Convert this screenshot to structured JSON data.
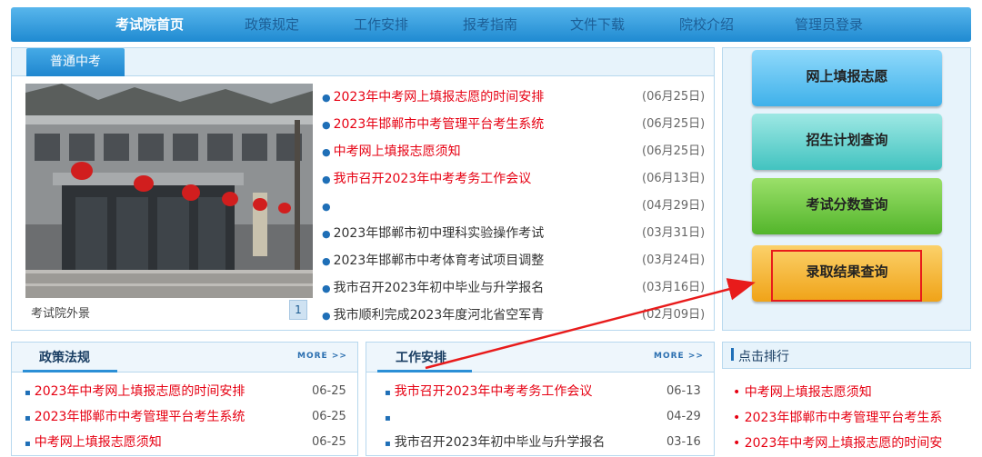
{
  "nav": {
    "items": [
      {
        "label": "考试院首页",
        "active": true
      },
      {
        "label": "政策规定",
        "active": false
      },
      {
        "label": "工作安排",
        "active": false
      },
      {
        "label": "报考指南",
        "active": false
      },
      {
        "label": "文件下载",
        "active": false
      },
      {
        "label": "院校介绍",
        "active": false
      },
      {
        "label": "管理员登录",
        "active": false
      }
    ]
  },
  "main": {
    "tab_label": "普通中考",
    "photo_caption": "考试院外景",
    "pager_current": "1",
    "news": [
      {
        "title": "2023年中考网上填报志愿的时间安排",
        "date": "(06月25日)",
        "color": "red"
      },
      {
        "title": "2023年邯郸市中考管理平台考生系统",
        "date": "(06月25日)",
        "color": "red"
      },
      {
        "title": "中考网上填报志愿须知",
        "date": "(06月25日)",
        "color": "red"
      },
      {
        "title": "我市召开2023年中考考务工作会议",
        "date": "(06月13日)",
        "color": "red"
      },
      {
        "title": "",
        "date": "(04月29日)",
        "color": "dark"
      },
      {
        "title": "2023年邯郸市初中理科实验操作考试",
        "date": "(03月31日)",
        "color": "dark"
      },
      {
        "title": "2023年邯郸市中考体育考试项目调整",
        "date": "(03月24日)",
        "color": "dark"
      },
      {
        "title": "我市召开2023年初中毕业与升学报名",
        "date": "(03月16日)",
        "color": "dark"
      },
      {
        "title": "我市顺利完成2023年度河北省空军青",
        "date": "(02月09日)",
        "color": "dark"
      }
    ]
  },
  "quick": {
    "buttons": [
      "网上填报志愿",
      "招生计划查询",
      "考试分数查询",
      "录取结果查询"
    ]
  },
  "policy": {
    "title": "政策法规",
    "more": "MORE >>",
    "items": [
      {
        "title": "2023年中考网上填报志愿的时间安排",
        "date": "06-25"
      },
      {
        "title": "2023年邯郸市中考管理平台考生系统",
        "date": "06-25"
      },
      {
        "title": "中考网上填报志愿须知",
        "date": "06-25"
      }
    ]
  },
  "work": {
    "title": "工作安排",
    "more": "MORE >>",
    "items": [
      {
        "title": "我市召开2023年中考考务工作会议",
        "date": "06-13"
      },
      {
        "title": "",
        "date": "04-29"
      },
      {
        "title": "我市召开2023年初中毕业与升学报名",
        "date": "03-16"
      }
    ]
  },
  "ranking": {
    "title": "点击排行",
    "items": [
      "中考网上填报志愿须知",
      "2023年邯郸市中考管理平台考生系",
      "2023年中考网上填报志愿的时间安"
    ]
  },
  "colors": {
    "nav_active": "#ffffff",
    "nav_inactive": "#1d5f97",
    "headline_red": "#e60012",
    "highlight": "#e81b1b"
  }
}
